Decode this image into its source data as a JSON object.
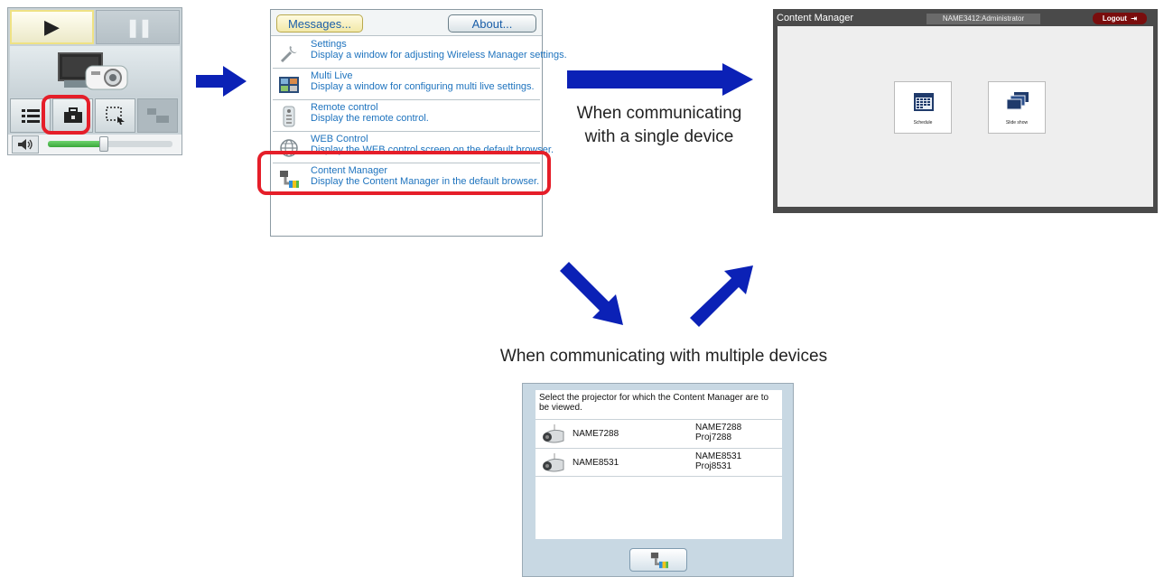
{
  "wireless_manager": {
    "play_glyph": "▶",
    "pause_glyph": "❚❚",
    "icons": [
      "projector-icon",
      "list-icon",
      "toolbox-icon",
      "selection-icon",
      "multi-window-icon",
      "speaker-icon"
    ],
    "volume_level": 0.45
  },
  "tool_menu": {
    "messages_label": "Messages...",
    "about_label": "About...",
    "items": [
      {
        "icon": "wrench-icon",
        "title": "Settings",
        "description": "Display a window for adjusting Wireless Manager settings."
      },
      {
        "icon": "multi-live-icon",
        "title": "Multi Live",
        "description": "Display a window for configuring multi live settings."
      },
      {
        "icon": "remote-icon",
        "title": "Remote control",
        "description": "Display the remote control."
      },
      {
        "icon": "globe-icon",
        "title": "WEB Control",
        "description": "Display the WEB control screen on the default browser."
      },
      {
        "icon": "content-manager-icon",
        "title": "Content Manager",
        "description": "Display the Content Manager in the default browser."
      }
    ]
  },
  "captions": {
    "single_line1": "When communicating",
    "single_line2": "with a single device",
    "multiple": "When communicating with multiple devices"
  },
  "content_manager": {
    "title": "Content Manager",
    "user": "NAME3412:Administrator",
    "logout_label": "Logout",
    "tiles": [
      {
        "icon": "calendar-icon",
        "label": "Schedule"
      },
      {
        "icon": "slideshow-icon",
        "label": "Slide show"
      }
    ]
  },
  "projector_select": {
    "message": "Select the projector for which the Content Manager are to be viewed.",
    "rows": [
      {
        "name": "NAME7288",
        "id_line1": "NAME7288",
        "id_line2": "Proj7288"
      },
      {
        "name": "NAME8531",
        "id_line1": "NAME8531",
        "id_line2": "Proj8531"
      }
    ]
  },
  "colors": {
    "arrow": "#0b21b6",
    "highlight": "#e51e29",
    "link_text": "#1e73be",
    "logout": "#7a0d0d"
  }
}
